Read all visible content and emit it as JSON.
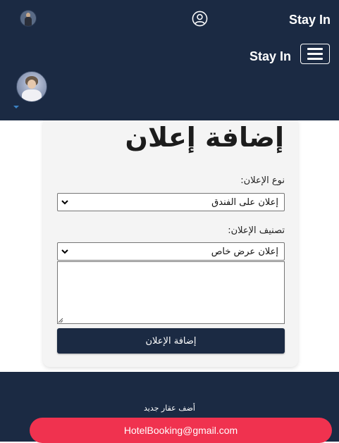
{
  "header": {
    "brand_top": "Stay In",
    "brand_nav": "Stay In",
    "icons": {
      "user": "user-circle-icon",
      "menu": "hamburger-menu-icon",
      "caret": "caret-down-icon"
    }
  },
  "form": {
    "title": "إضافة إعلان",
    "ad_type_label": "نوع الإعلان:",
    "ad_type_value": "إعلان على الفندق",
    "ad_category_label": "تصنيف الإعلان:",
    "ad_category_value": "إعلان عرض خاص",
    "description_value": "",
    "submit_label": "إضافة الإعلان"
  },
  "footer": {
    "add_property_link": "أضف عقار جديد",
    "email": "HotelBooking@gmail.com"
  },
  "colors": {
    "navy": "#1b2a43",
    "accent_red": "#f0324f"
  }
}
